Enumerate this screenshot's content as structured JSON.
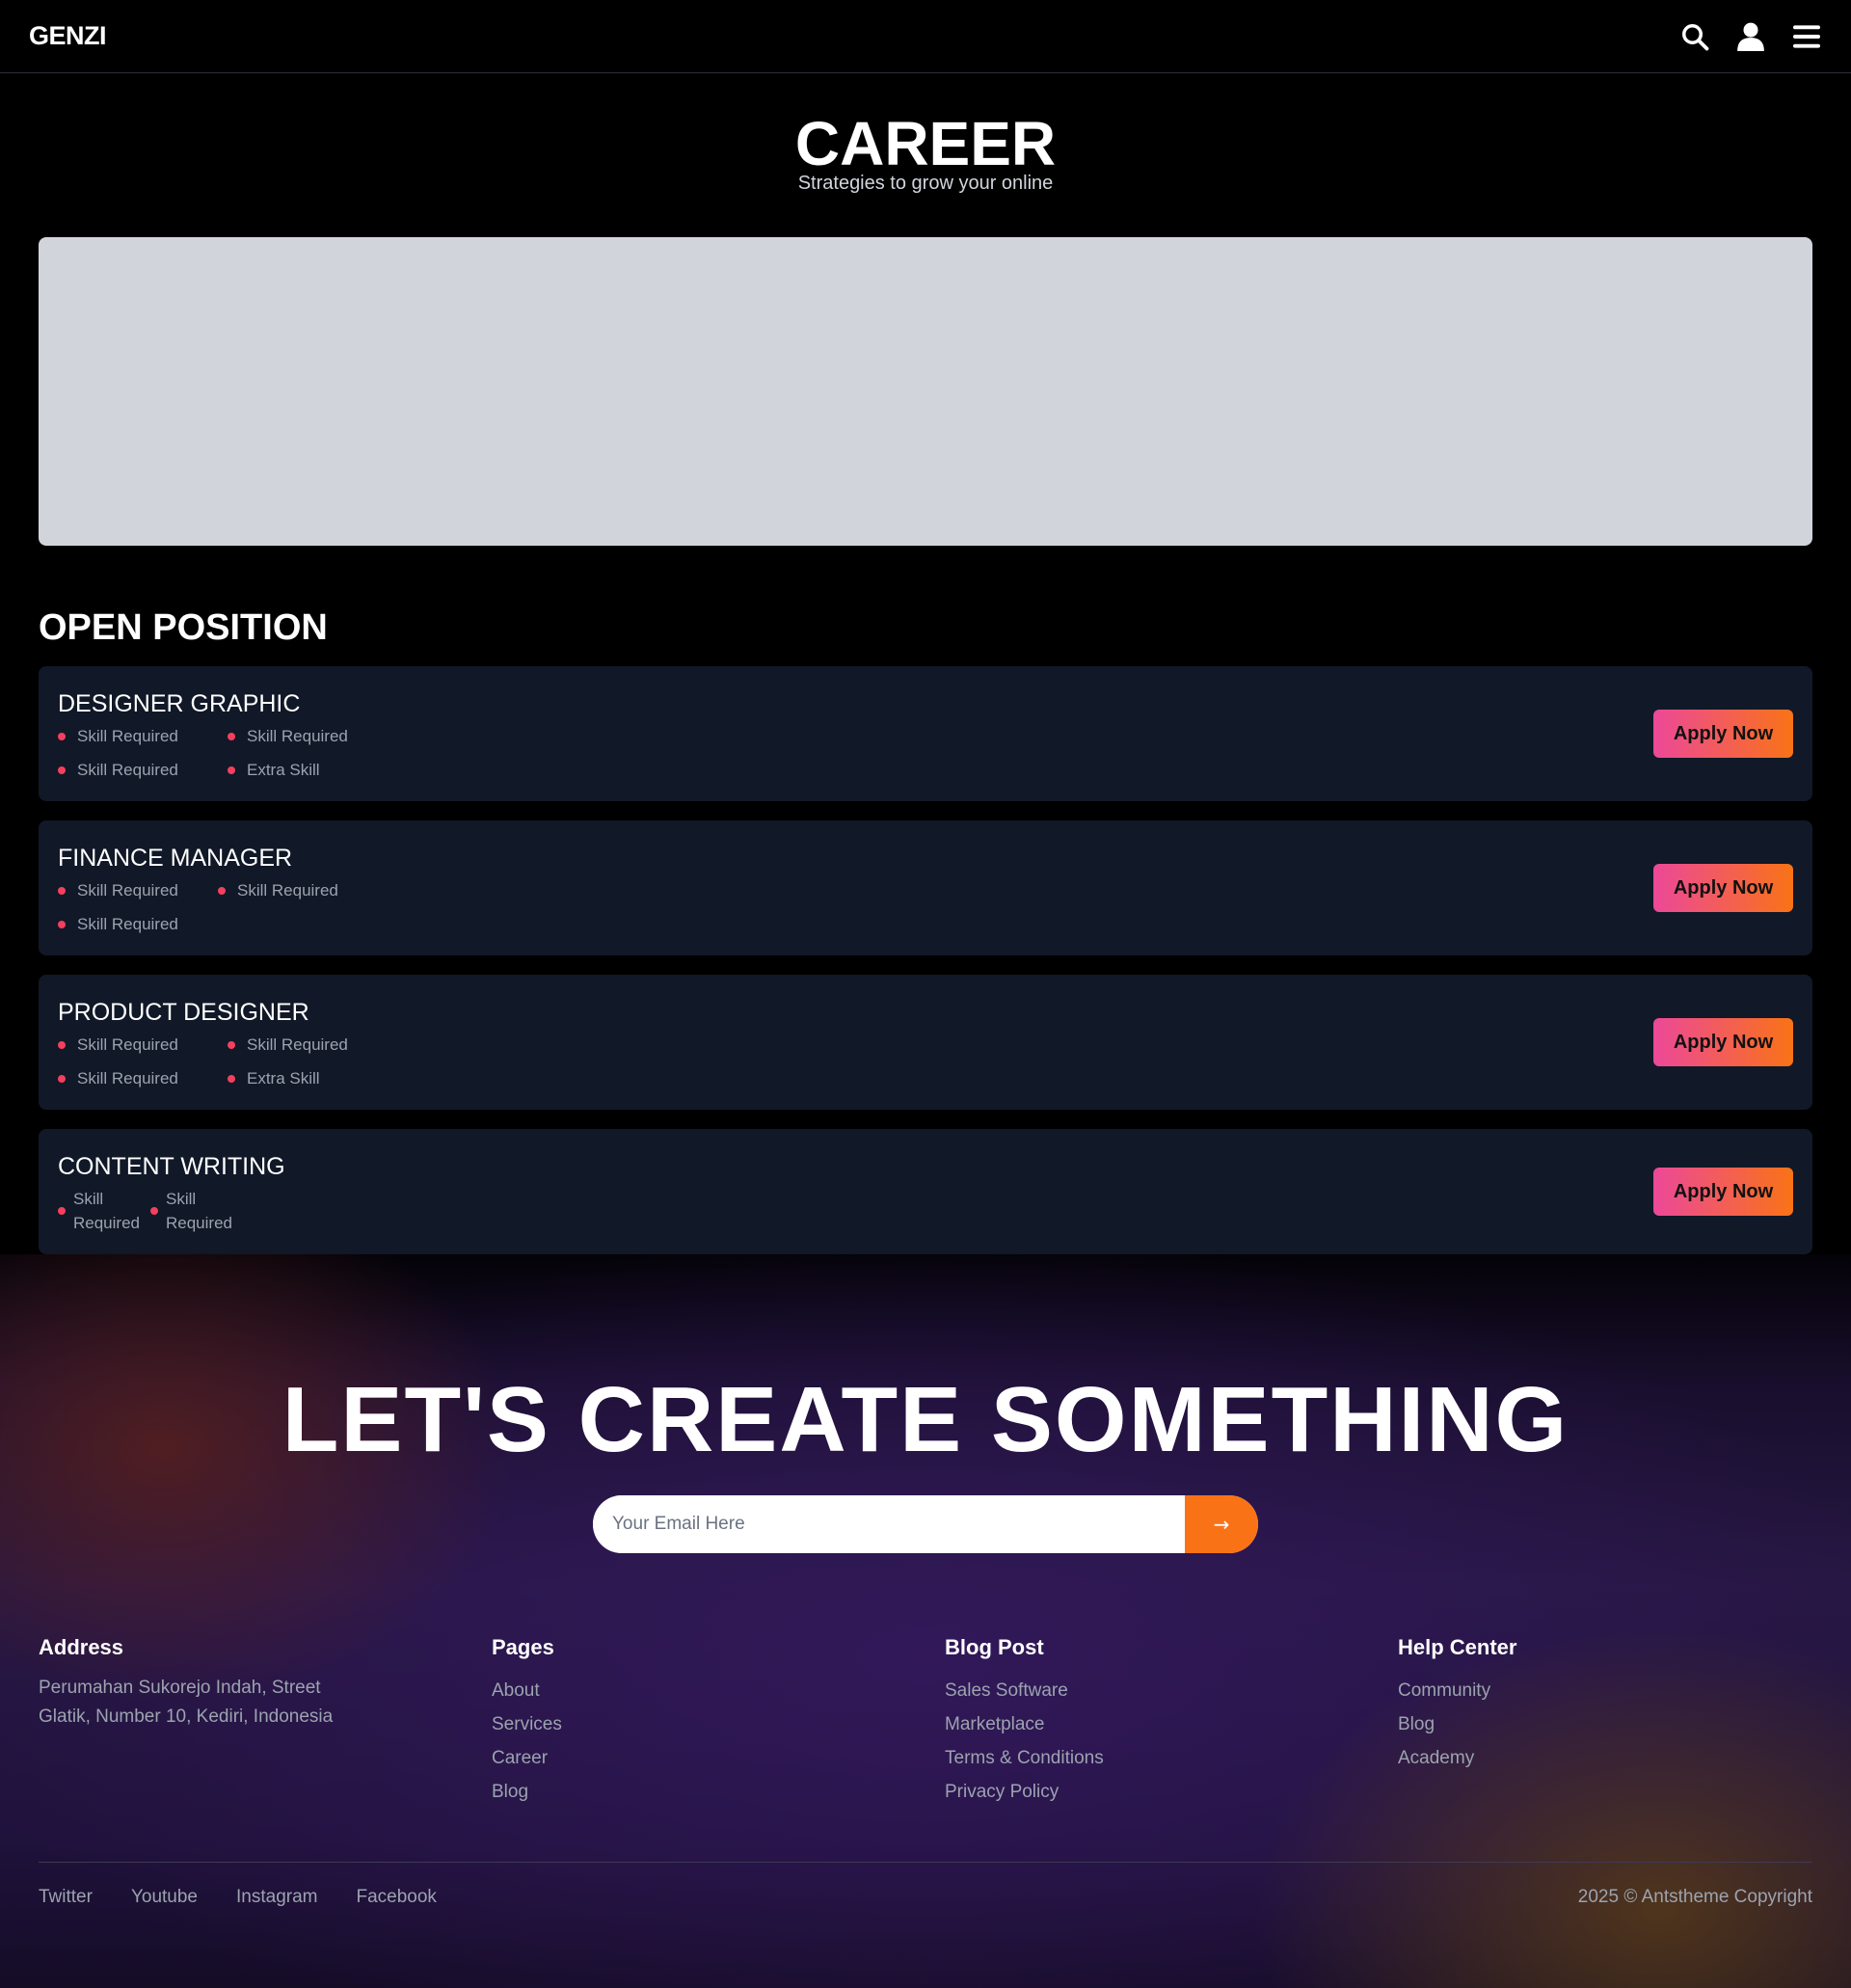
{
  "header": {
    "logo": "GENZI",
    "icons": [
      "search-icon",
      "user-icon",
      "menu-icon"
    ]
  },
  "hero": {
    "title": "CAREER",
    "subtitle": "Strategies to grow your online"
  },
  "positions": {
    "title": "OPEN POSITION",
    "apply_label": "Apply Now",
    "jobs": [
      {
        "title": "DESIGNER GRAPHIC",
        "skills": [
          "Skill Required",
          "Skill Required",
          "Skill Required",
          "Extra Skill"
        ]
      },
      {
        "title": "FINANCE MANAGER",
        "skills": [
          "Skill Required",
          "Skill Required",
          "Skill Required"
        ]
      },
      {
        "title": "PRODUCT DESIGNER",
        "skills": [
          "Skill Required",
          "Skill Required",
          "Skill Required",
          "Extra Skill"
        ]
      },
      {
        "title": "CONTENT WRITING",
        "skills": [
          "Skill Required",
          "Skill Required"
        ]
      }
    ]
  },
  "cta": {
    "title": "LET'S CREATE SOMETHING",
    "email_placeholder": "Your Email Here",
    "submit_label": "→"
  },
  "footer": {
    "address": {
      "title": "Address",
      "text": "Perumahan Sukorejo Indah, Street Glatik, Number 10, Kediri, Indonesia"
    },
    "pages": {
      "title": "Pages",
      "links": [
        "About",
        "Services",
        "Career",
        "Blog"
      ]
    },
    "blog": {
      "title": "Blog Post",
      "links": [
        "Sales Software",
        "Marketplace",
        "Terms & Conditions",
        "Privacy Policy"
      ]
    },
    "help": {
      "title": "Help Center",
      "links": [
        "Community",
        "Blog",
        "Academy"
      ]
    },
    "socials": [
      "Twitter",
      "Youtube",
      "Instagram",
      "Facebook"
    ],
    "copyright": "2025 © Antstheme Copyright"
  },
  "colors": {
    "accent_start": "#ec4899",
    "accent_end": "#f97316",
    "card_bg": "#111827",
    "skill_dot": "#f43f5e",
    "banner": "#d1d5db"
  }
}
